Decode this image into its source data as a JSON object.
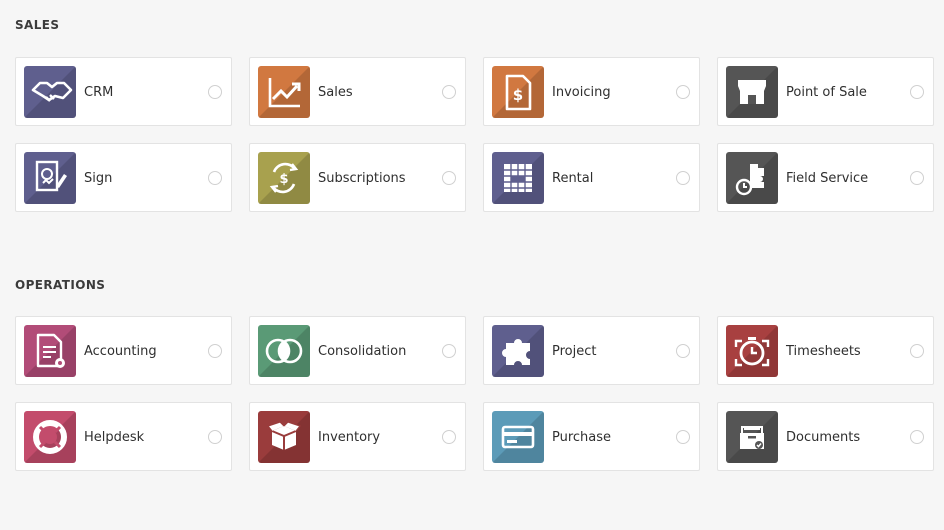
{
  "sections": [
    {
      "title": "SALES",
      "apps": [
        {
          "label": "CRM",
          "icon": "handshake-icon",
          "color": "#5f5f8e"
        },
        {
          "label": "Sales",
          "icon": "trend-chart-icon",
          "color": "#d17840"
        },
        {
          "label": "Invoicing",
          "icon": "invoice-dollar-icon",
          "color": "#d17840"
        },
        {
          "label": "Point of Sale",
          "icon": "store-icon",
          "color": "#555555"
        },
        {
          "label": "Sign",
          "icon": "sign-document-icon",
          "color": "#5f5f8e"
        },
        {
          "label": "Subscriptions",
          "icon": "recurring-dollar-icon",
          "color": "#a8a14e"
        },
        {
          "label": "Rental",
          "icon": "rental-grid-icon",
          "color": "#5f5f8e"
        },
        {
          "label": "Field Service",
          "icon": "field-service-icon",
          "color": "#555555"
        }
      ]
    },
    {
      "title": "OPERATIONS",
      "apps": [
        {
          "label": "Accounting",
          "icon": "accounting-document-icon",
          "color": "#b24c78"
        },
        {
          "label": "Consolidation",
          "icon": "overlap-circles-icon",
          "color": "#5a9a76"
        },
        {
          "label": "Project",
          "icon": "puzzle-icon",
          "color": "#5f5f8e"
        },
        {
          "label": "Timesheets",
          "icon": "stopwatch-icon",
          "color": "#a84040"
        },
        {
          "label": "Helpdesk",
          "icon": "lifebuoy-icon",
          "color": "#c34c6c"
        },
        {
          "label": "Inventory",
          "icon": "box-icon",
          "color": "#9a3c3c"
        },
        {
          "label": "Purchase",
          "icon": "credit-card-icon",
          "color": "#5c9bb8"
        },
        {
          "label": "Documents",
          "icon": "document-tray-icon",
          "color": "#555555"
        }
      ]
    }
  ]
}
